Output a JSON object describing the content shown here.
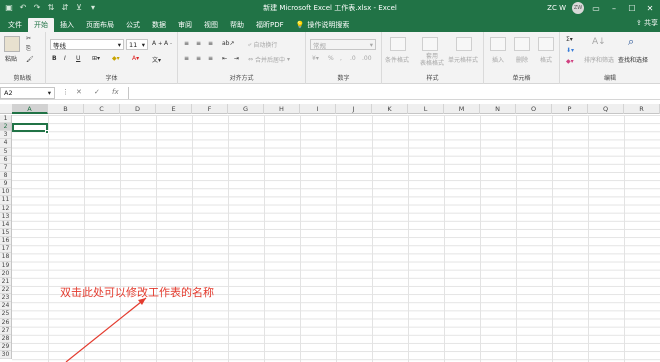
{
  "title": "新建 Microsoft Excel 工作表.xlsx  -  Excel",
  "user": {
    "name": "ZC W",
    "avatar": "ZW"
  },
  "share_label": "共享",
  "tabs": [
    "文件",
    "开始",
    "插入",
    "页面布局",
    "公式",
    "数据",
    "审阅",
    "视图",
    "帮助",
    "福昕PDF"
  ],
  "active_tab": "开始",
  "tell_me": "操作说明搜索",
  "ribbon": {
    "clipboard": {
      "paste": "粘贴",
      "label": "剪贴板"
    },
    "font": {
      "name": "等线",
      "size": "11",
      "label": "字体",
      "bold": "B",
      "italic": "I",
      "underline": "U"
    },
    "alignment": {
      "wrap": "自动换行",
      "merge": "合并后居中",
      "label": "对齐方式"
    },
    "number": {
      "format": "常规",
      "label": "数字"
    },
    "styles": {
      "conditional": "条件格式",
      "table": "套用\n表格格式",
      "cell_styles": "单元格样式",
      "label": "样式"
    },
    "cells": {
      "insert": "插入",
      "delete": "删除",
      "format": "格式",
      "label": "单元格"
    },
    "editing": {
      "sort": "排序和筛选",
      "find": "查找和选择",
      "label": "编辑"
    }
  },
  "formula_bar": {
    "name_box": "A2",
    "fx": "fx",
    "value": ""
  },
  "columns": [
    "A",
    "B",
    "C",
    "D",
    "E",
    "F",
    "G",
    "H",
    "I",
    "J",
    "K",
    "L",
    "M",
    "N",
    "O",
    "P",
    "Q",
    "R"
  ],
  "rows": [
    "1",
    "2",
    "3",
    "4",
    "5",
    "6",
    "7",
    "8",
    "9",
    "10",
    "11",
    "12",
    "13",
    "14",
    "15",
    "16",
    "17",
    "18",
    "19",
    "20",
    "21",
    "22",
    "23",
    "24",
    "25",
    "26",
    "27",
    "28",
    "29",
    "30"
  ],
  "selected_cell": "A2",
  "annotation": "双击此处可以修改工作表的名称",
  "colors": {
    "accent": "#217346",
    "annotation": "#e33b2e"
  }
}
